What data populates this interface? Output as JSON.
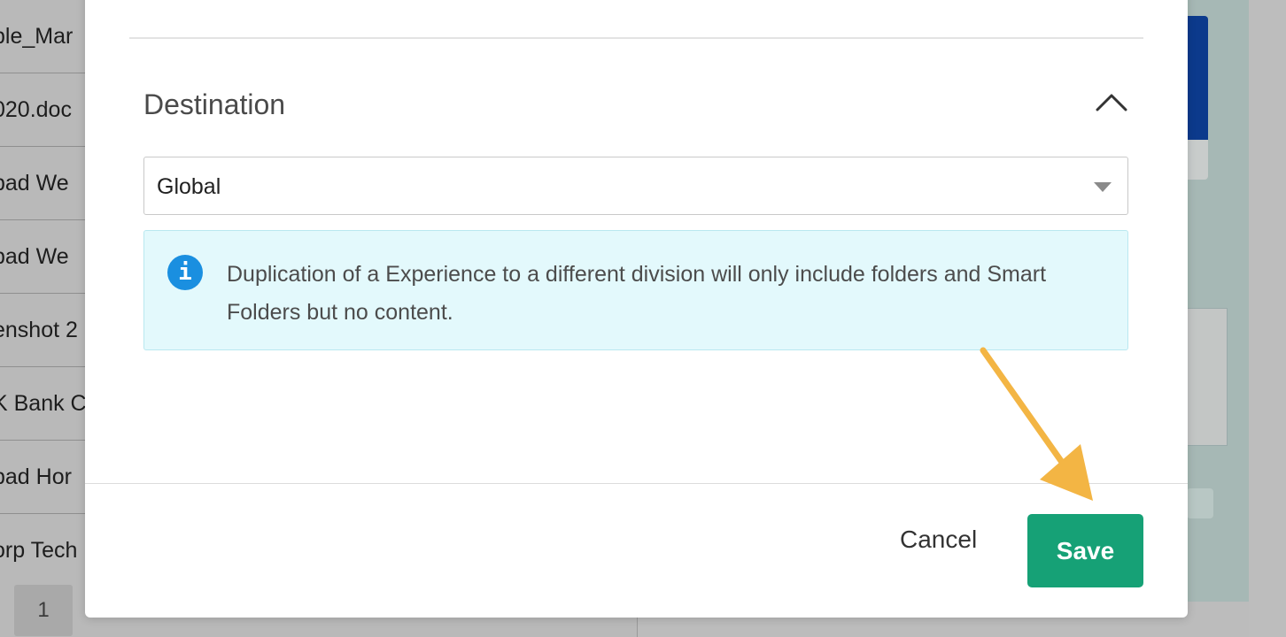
{
  "background": {
    "list_rows": [
      "ple_Mar",
      "020.doc",
      "pad We",
      "pad We",
      "enshot 2",
      "K Bank C",
      "pad Hor",
      "orp Tech"
    ],
    "pagination": {
      "current": "1"
    }
  },
  "modal": {
    "section_title": "Destination",
    "destination_select": {
      "value": "Global"
    },
    "info_message": "Duplication of a Experience to a different division will only include folders and Smart Folders but no content.",
    "info_icon": "info-icon",
    "cancel_label": "Cancel",
    "save_label": "Save"
  },
  "colors": {
    "save_button": "#16a176",
    "info_background": "#e3f9fc",
    "info_icon": "#1a8fe0",
    "annotation_arrow": "#f3b544"
  }
}
